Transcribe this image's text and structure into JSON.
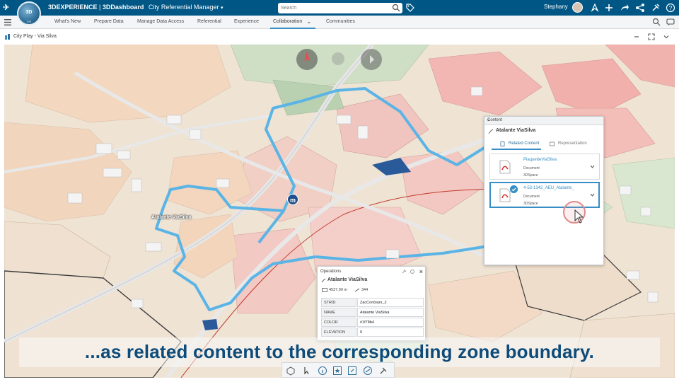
{
  "header": {
    "brand_bold": "3DEXPERIENCE",
    "brand_sep": " | ",
    "brand_app": "3DDashboard",
    "dashboard_name": "City Referential Manager",
    "compass_label": "3D",
    "compass_version": "V,R",
    "search_placeholder": "Search",
    "user_name": "Stephany"
  },
  "tabs": [
    {
      "label": "What's New"
    },
    {
      "label": "Prepare Data"
    },
    {
      "label": "Manage Data Access"
    },
    {
      "label": "Referential"
    },
    {
      "label": "Experience"
    },
    {
      "label": "Collaboration"
    },
    {
      "label": "Communities"
    }
  ],
  "widget": {
    "title": "City Play - Via Silva"
  },
  "map": {
    "place_label": "Atalante ViaSilva",
    "metro_label": "m"
  },
  "content_panel": {
    "title": "Content",
    "object_name": "Atalante ViaSilva",
    "tabs": [
      {
        "label": "Related Content"
      },
      {
        "label": "Representation"
      }
    ],
    "items": [
      {
        "title": "PlaquetteViaSilva",
        "type": "Document",
        "source": "3DSpace",
        "selected": false
      },
      {
        "title": "4-53-1342_AEU_Atalante_",
        "type": "Document",
        "source": "3DSpace",
        "selected": true
      }
    ]
  },
  "operations_panel": {
    "title": "Operations",
    "object_name": "Atalante ViaSilva",
    "perimeter": "4527.90 m",
    "segments": "344",
    "rows": [
      {
        "key": "STRID",
        "value": "ZacContours_2"
      },
      {
        "key": "NAME",
        "value": "Atalante ViaSilva"
      },
      {
        "key": "COLOR",
        "value": "#1f78b4"
      },
      {
        "key": "ELEVATION",
        "value": "0"
      }
    ]
  },
  "caption": {
    "text": "...as related content to the corresponding zone boundary."
  },
  "colors": {
    "topbar": "#005685",
    "accent": "#368ec4",
    "boundary": "#5ab4e5",
    "caption_text": "#0d4b7a"
  }
}
